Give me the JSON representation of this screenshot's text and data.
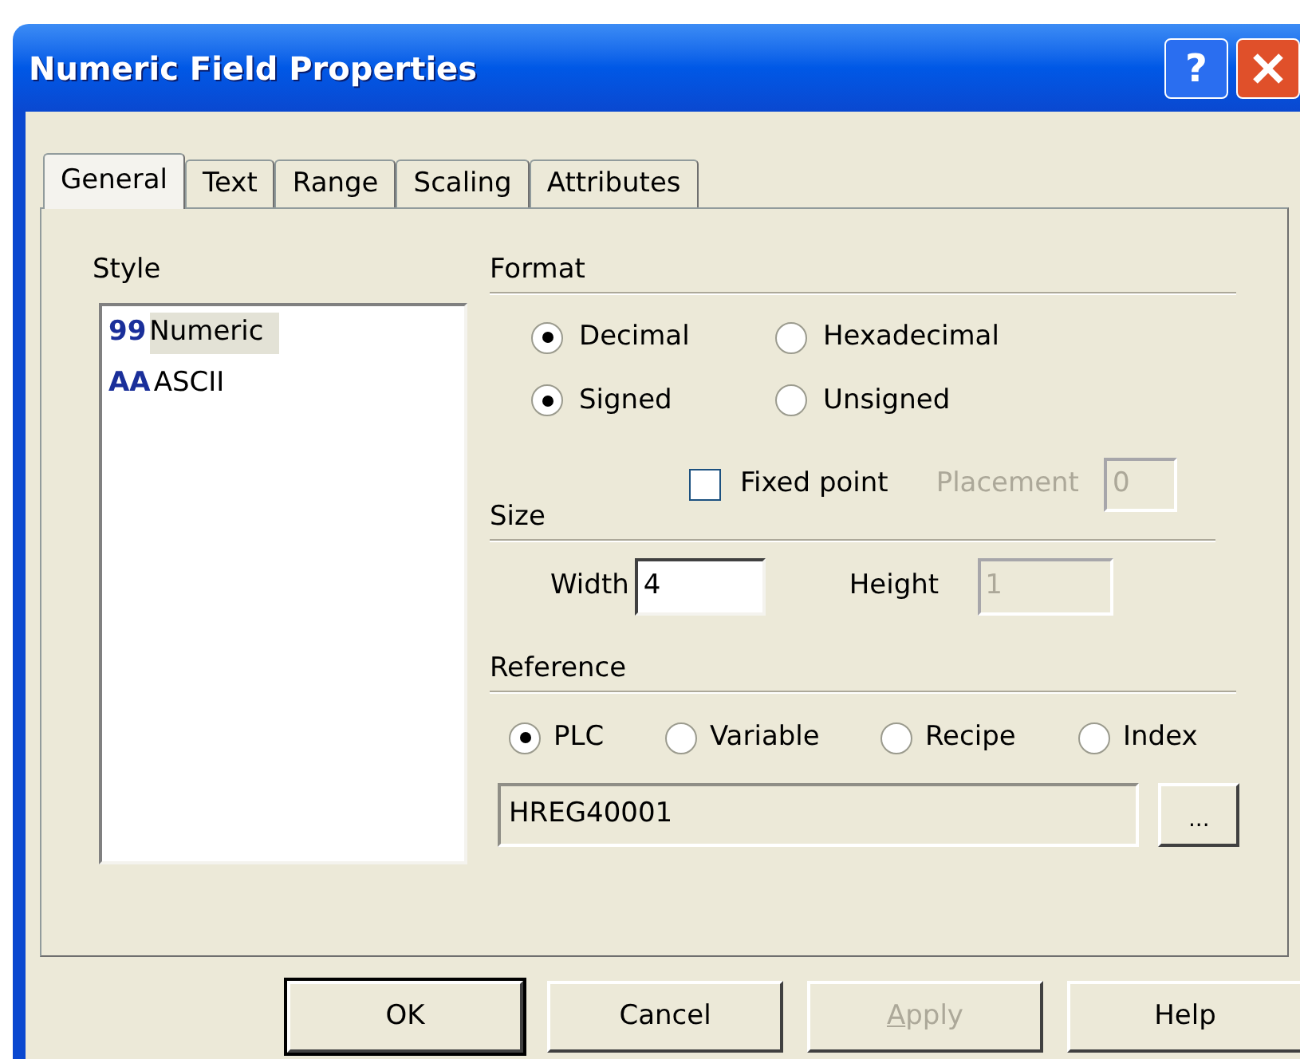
{
  "window": {
    "title": "Numeric Field Properties",
    "help_label": "?"
  },
  "tabs": [
    {
      "label": "General",
      "selected": true
    },
    {
      "label": "Text",
      "selected": false
    },
    {
      "label": "Range",
      "selected": false
    },
    {
      "label": "Scaling",
      "selected": false
    },
    {
      "label": "Attributes",
      "selected": false
    }
  ],
  "style": {
    "label": "Style",
    "items": [
      {
        "icon_text": "99",
        "label": "Numeric",
        "selected": true
      },
      {
        "icon_text": "AA",
        "label": "ASCII",
        "selected": false
      }
    ]
  },
  "format": {
    "label": "Format",
    "rows": [
      {
        "options": [
          {
            "label": "Decimal",
            "selected": true
          },
          {
            "label": "Hexadecimal",
            "selected": false
          }
        ]
      },
      {
        "options": [
          {
            "label": "Signed",
            "selected": true
          },
          {
            "label": "Unsigned",
            "selected": false
          }
        ]
      }
    ],
    "fixed_point": {
      "label": "Fixed point",
      "checked": false
    },
    "placement": {
      "label": "Placement",
      "value": "0",
      "disabled": true
    }
  },
  "size": {
    "label": "Size",
    "width": {
      "label": "Width",
      "value": "4",
      "disabled": false
    },
    "height": {
      "label": "Height",
      "value": "1",
      "disabled": true
    }
  },
  "reference": {
    "label": "Reference",
    "options": [
      {
        "label": "PLC",
        "selected": true
      },
      {
        "label": "Variable",
        "selected": false
      },
      {
        "label": "Recipe",
        "selected": false
      },
      {
        "label": "Index",
        "selected": false
      }
    ],
    "value": "HREG40001",
    "browse_label": "..."
  },
  "buttons": [
    {
      "label": "OK",
      "default": true,
      "disabled": false
    },
    {
      "label": "Cancel",
      "default": false,
      "disabled": false
    },
    {
      "label": "Apply",
      "default": false,
      "disabled": true,
      "access_key_underlined": true
    },
    {
      "label": "Help",
      "default": false,
      "disabled": false
    }
  ]
}
